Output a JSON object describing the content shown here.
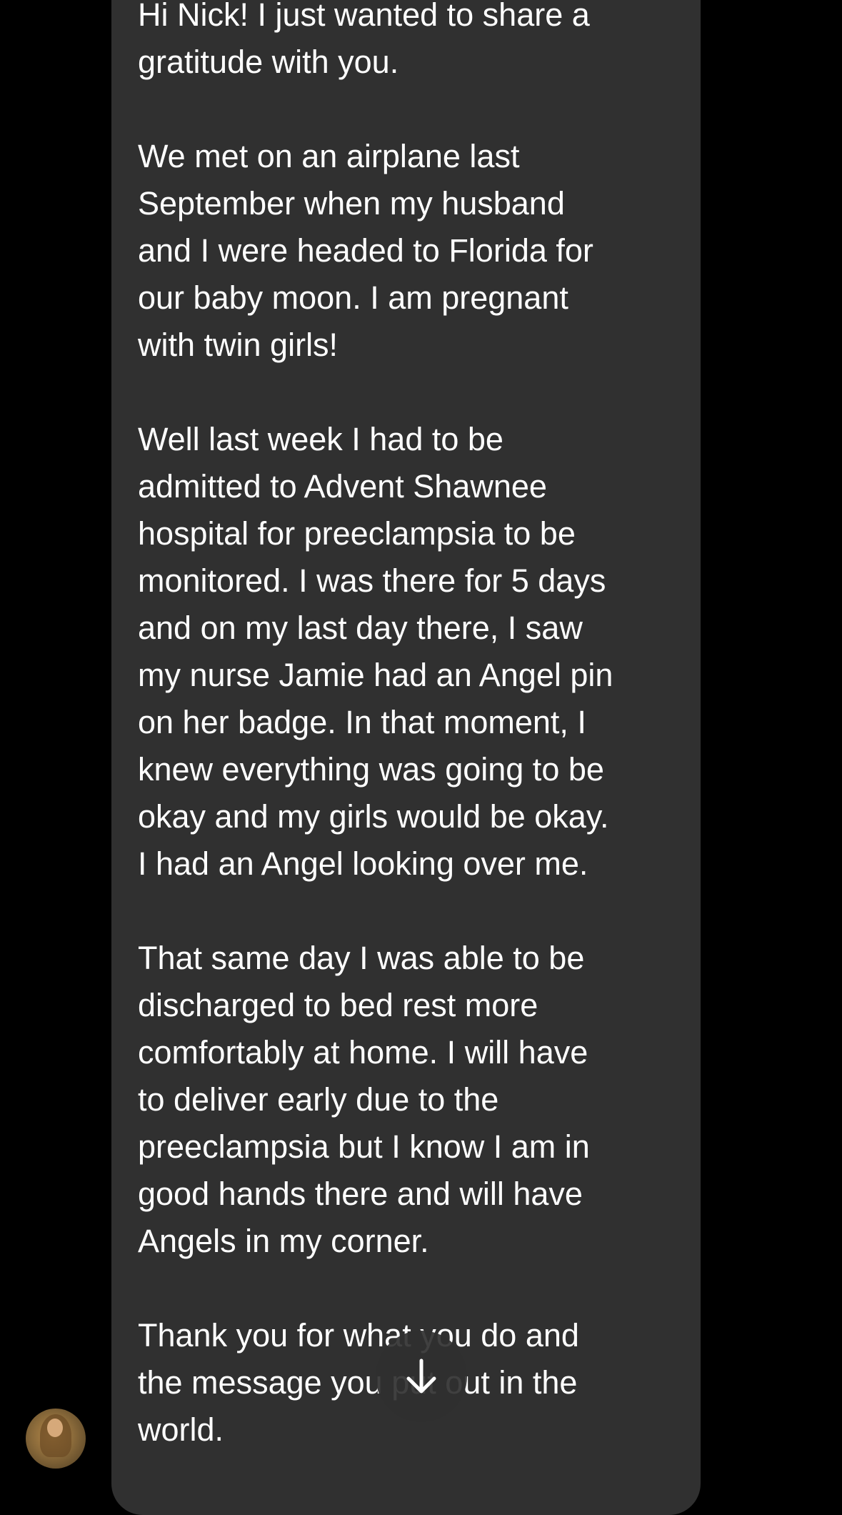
{
  "conversation": {
    "message": {
      "text": "Hi Nick! I just wanted to share a\ngratitude with you.\n\nWe met on an airplane last\nSeptember when my husband\nand I were headed to Florida for\nour baby moon. I am pregnant\nwith twin girls!\n\nWell last week I had to be\nadmitted to Advent Shawnee\nhospital for preeclampsia to be\nmonitored. I was there for 5 days\nand on my last day there, I saw\nmy nurse Jamie had an Angel pin\non her badge. In that moment, I\nknew everything was going to be\nokay and my girls would be okay.\nI had an Angel looking over me.\n\nThat same day I was able to be\ndischarged to bed rest more\ncomfortably at home. I will have\nto deliver early due to the\npreeclampsia but I know I am in\ngood hands there and will have\nAngels in my corner.\n\nThank you for what you do and\nthe message you put out in the\nworld."
    }
  },
  "controls": {
    "scroll_down_icon": "arrow-down-icon"
  },
  "colors": {
    "background": "#000000",
    "bubble": "#303030",
    "text": "#ffffff"
  }
}
